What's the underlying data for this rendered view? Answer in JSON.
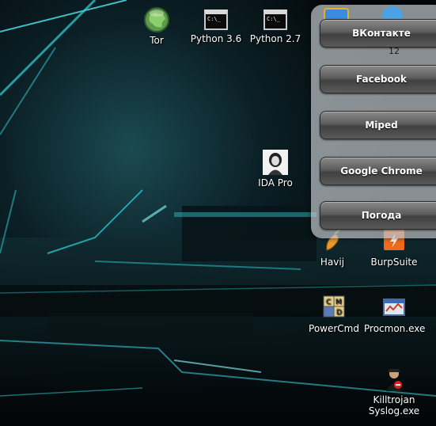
{
  "desktop_icons": [
    {
      "label": "Tor",
      "icon": "tor-globe-icon"
    },
    {
      "label": "Python 3.6",
      "icon": "terminal-icon"
    },
    {
      "label": "Python 2.7",
      "icon": "terminal-icon"
    },
    {
      "label": "IDA Pro",
      "icon": "ida-pro-icon"
    },
    {
      "label": "Havij",
      "icon": "havij-icon"
    },
    {
      "label": "BurpSuite",
      "icon": "burpsuite-icon"
    },
    {
      "label": "PowerCmd",
      "icon": "powercmd-icon"
    },
    {
      "label": "Procmon.exe",
      "icon": "procmon-icon"
    },
    {
      "label": "Killtrojan",
      "label2": "Syslog.exe",
      "icon": "killtrojan-icon"
    }
  ],
  "terminal_prompt": "C:\\_",
  "gadget": {
    "buttons": [
      "ВКонтакте",
      "Facebook",
      "Miped",
      "Google Chrome",
      "Погода"
    ],
    "peek_number": "12"
  },
  "colors": {
    "accent_cyan": "#2fd4d8",
    "panel": "#bec3c8",
    "button_dark": "#404040"
  }
}
